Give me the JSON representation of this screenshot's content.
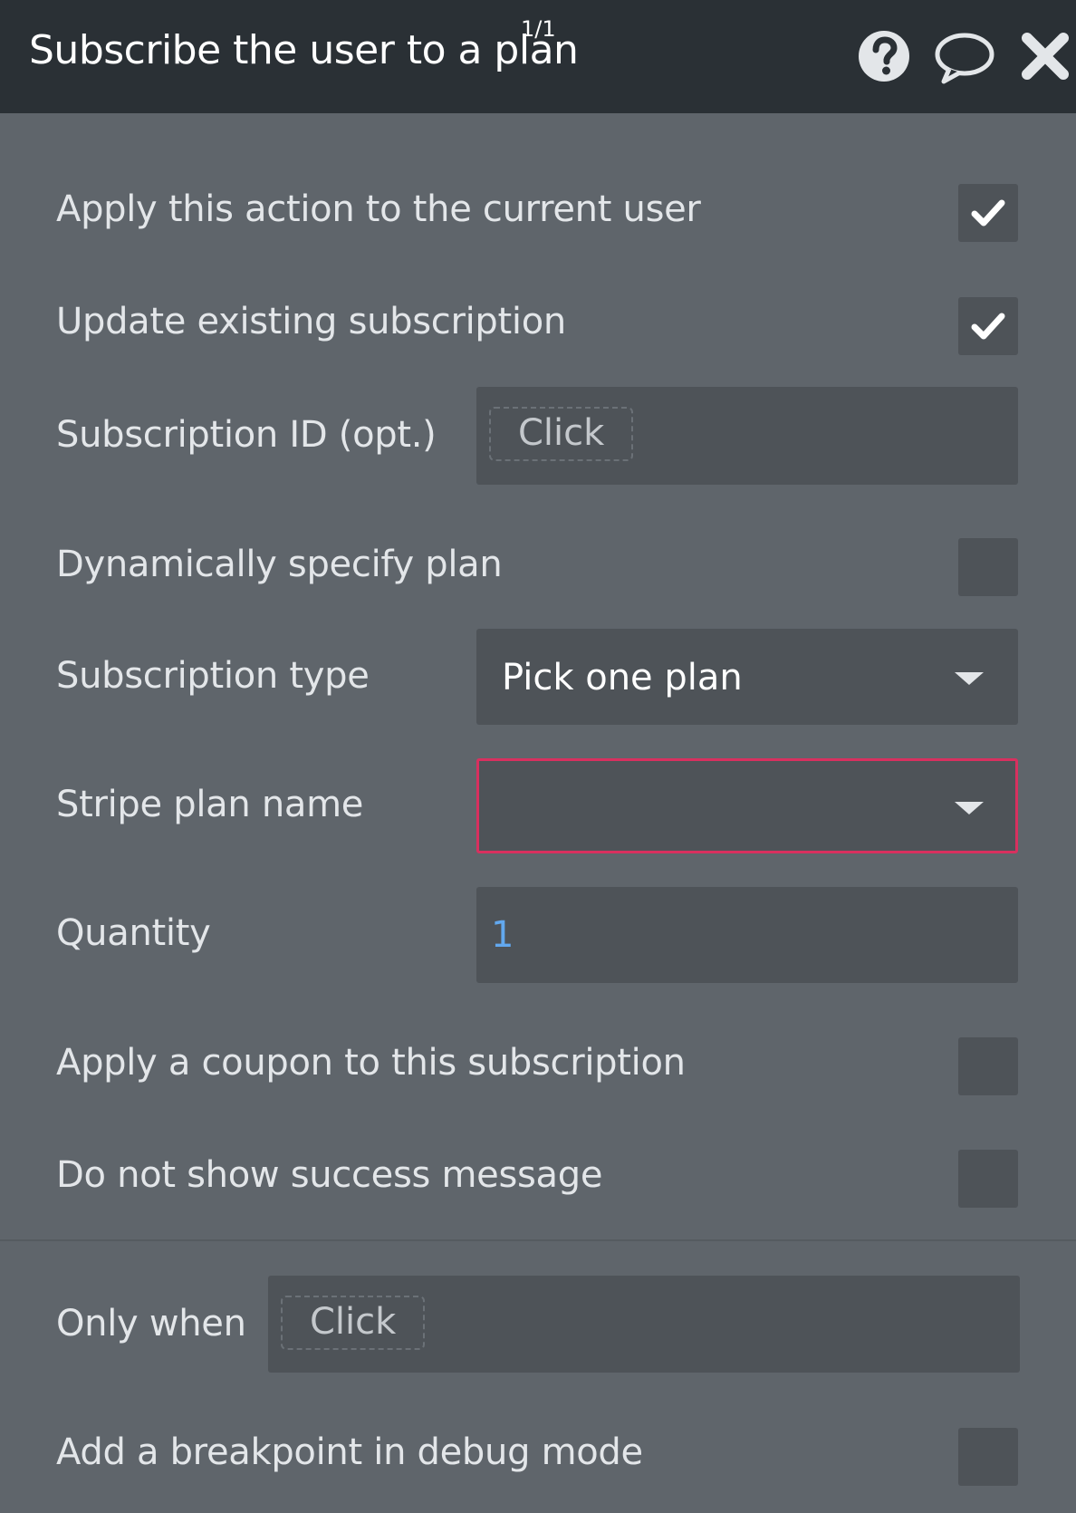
{
  "header": {
    "title": "Subscribe the user to a plan",
    "counter": "1/1",
    "icons": [
      "help-icon",
      "comment-icon",
      "close-icon"
    ]
  },
  "fields": {
    "apply_current_user": {
      "label": "Apply this action to the current user",
      "checked": true
    },
    "update_existing": {
      "label": "Update existing subscription",
      "checked": true
    },
    "subscription_id": {
      "label": "Subscription ID (opt.)",
      "placeholder": "Click"
    },
    "dynamic_plan": {
      "label": "Dynamically specify plan",
      "checked": false
    },
    "subscription_type": {
      "label": "Subscription type",
      "value": "Pick one plan"
    },
    "stripe_plan": {
      "label": "Stripe plan name",
      "value": ""
    },
    "quantity": {
      "label": "Quantity",
      "value": "1"
    },
    "apply_coupon": {
      "label": "Apply a coupon to this subscription",
      "checked": false
    },
    "no_success_message": {
      "label": "Do not show success message",
      "checked": false
    }
  },
  "conditions": {
    "only_when": {
      "label": "Only when",
      "placeholder": "Click"
    },
    "breakpoint": {
      "label": "Add a breakpoint in debug mode",
      "checked": false
    }
  },
  "colors": {
    "panel_bg": "#5f656b",
    "header_bg": "#2a3035",
    "field_bg": "#4e5358",
    "error_border": "#d8305f",
    "value_accent": "#62a8ee"
  }
}
